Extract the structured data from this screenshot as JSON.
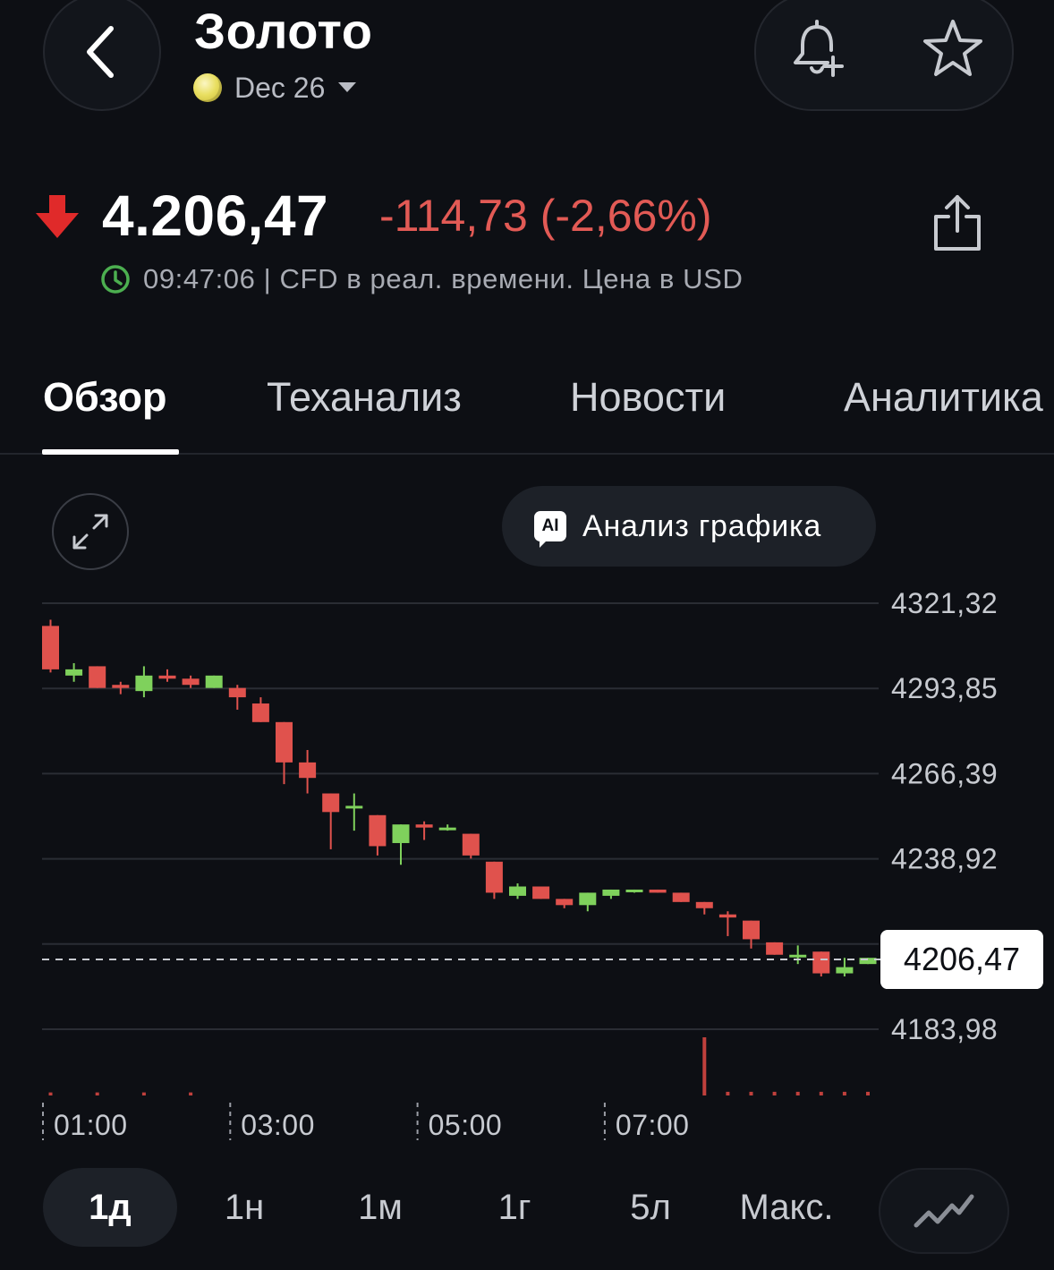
{
  "header": {
    "title": "Золото",
    "contract": "Dec 26",
    "back_icon": "chevron-left-icon",
    "alert_icon": "bell-plus-icon",
    "watchlist_icon": "star-icon"
  },
  "quote": {
    "price": "4.206,47",
    "change": "-114,73 (-2,66%)",
    "direction_icon": "arrow-down-icon",
    "meta": "09:47:06 | CFD в реал. времени. Цена в USD",
    "colors": {
      "down": "#e25a55",
      "up": "#7fd15c",
      "clock": "#4caf50"
    }
  },
  "tabs": [
    {
      "label": "Обзор",
      "active": true
    },
    {
      "label": "Теханализ",
      "active": false
    },
    {
      "label": "Новости",
      "active": false
    },
    {
      "label": "Аналитика",
      "active": false
    }
  ],
  "chart_controls": {
    "ai_button_label": "Анализ графика",
    "ai_badge": "AI",
    "expand_icon": "expand-icon"
  },
  "chart_data": {
    "type": "candlestick",
    "y_ticks": [
      4321.32,
      4293.85,
      4266.39,
      4238.92,
      4211.45,
      4183.98
    ],
    "y_tick_labels": [
      "4321,32",
      "4293,85",
      "4266,39",
      "4238,92",
      "",
      "4183,98"
    ],
    "ylim": [
      4183.98,
      4321.32
    ],
    "current_price": 4206.47,
    "current_price_label": "4206,47",
    "x_tick_labels": [
      "01:00",
      "03:00",
      "05:00",
      "07:00"
    ],
    "grid": true,
    "colors": {
      "up": "#7fd15c",
      "down": "#e0524d",
      "volume": "#c0403c"
    },
    "candles": [
      {
        "o": 4314,
        "h": 4316,
        "l": 4299,
        "c": 4300
      },
      {
        "o": 4298,
        "h": 4302,
        "l": 4296,
        "c": 4300
      },
      {
        "o": 4301,
        "h": 4301,
        "l": 4294,
        "c": 4294
      },
      {
        "o": 4295,
        "h": 4296,
        "l": 4292,
        "c": 4294
      },
      {
        "o": 4293,
        "h": 4301,
        "l": 4291,
        "c": 4298
      },
      {
        "o": 4298,
        "h": 4300,
        "l": 4296,
        "c": 4297
      },
      {
        "o": 4297,
        "h": 4298,
        "l": 4294,
        "c": 4295
      },
      {
        "o": 4294,
        "h": 4298,
        "l": 4294,
        "c": 4298
      },
      {
        "o": 4294,
        "h": 4295,
        "l": 4287,
        "c": 4291
      },
      {
        "o": 4289,
        "h": 4291,
        "l": 4283,
        "c": 4283
      },
      {
        "o": 4283,
        "h": 4283,
        "l": 4263,
        "c": 4270
      },
      {
        "o": 4270,
        "h": 4274,
        "l": 4260,
        "c": 4265
      },
      {
        "o": 4260,
        "h": 4260,
        "l": 4242,
        "c": 4254
      },
      {
        "o": 4256,
        "h": 4260,
        "l": 4248,
        "c": 4256
      },
      {
        "o": 4253,
        "h": 4253,
        "l": 4240,
        "c": 4243
      },
      {
        "o": 4244,
        "h": 4250,
        "l": 4237,
        "c": 4250
      },
      {
        "o": 4250,
        "h": 4251,
        "l": 4245,
        "c": 4249
      },
      {
        "o": 4249,
        "h": 4250,
        "l": 4248,
        "c": 4249
      },
      {
        "o": 4247,
        "h": 4247,
        "l": 4239,
        "c": 4240
      },
      {
        "o": 4238,
        "h": 4238,
        "l": 4226,
        "c": 4228
      },
      {
        "o": 4227,
        "h": 4231,
        "l": 4226,
        "c": 4230
      },
      {
        "o": 4230,
        "h": 4230,
        "l": 4226,
        "c": 4226
      },
      {
        "o": 4226,
        "h": 4226,
        "l": 4223,
        "c": 4224
      },
      {
        "o": 4224,
        "h": 4228,
        "l": 4222,
        "c": 4228
      },
      {
        "o": 4227,
        "h": 4229,
        "l": 4226,
        "c": 4229
      },
      {
        "o": 4229,
        "h": 4229,
        "l": 4228,
        "c": 4229
      },
      {
        "o": 4229,
        "h": 4229,
        "l": 4228,
        "c": 4228
      },
      {
        "o": 4228,
        "h": 4228,
        "l": 4225,
        "c": 4225
      },
      {
        "o": 4225,
        "h": 4225,
        "l": 4221,
        "c": 4223
      },
      {
        "o": 4221,
        "h": 4222,
        "l": 4214,
        "c": 4220
      },
      {
        "o": 4219,
        "h": 4219,
        "l": 4210,
        "c": 4213
      },
      {
        "o": 4212,
        "h": 4212,
        "l": 4208,
        "c": 4208
      },
      {
        "o": 4208,
        "h": 4211,
        "l": 4205,
        "c": 4208
      },
      {
        "o": 4209,
        "h": 4209,
        "l": 4201,
        "c": 4202
      },
      {
        "o": 4202,
        "h": 4207,
        "l": 4201,
        "c": 4204
      },
      {
        "o": 4205,
        "h": 4207,
        "l": 4205,
        "c": 4207
      }
    ],
    "volume": [
      2,
      0,
      2,
      0,
      2,
      0,
      2,
      0,
      0,
      0,
      0,
      0,
      0,
      0,
      0,
      0,
      0,
      0,
      0,
      0,
      0,
      0,
      0,
      0,
      0,
      0,
      0,
      0,
      90,
      3,
      3,
      3,
      3,
      3,
      3,
      3
    ]
  },
  "ranges": [
    {
      "label": "1д",
      "active": true
    },
    {
      "label": "1н",
      "active": false
    },
    {
      "label": "1м",
      "active": false
    },
    {
      "label": "1г",
      "active": false
    },
    {
      "label": "5л",
      "active": false
    },
    {
      "label": "Макс.",
      "active": false
    }
  ],
  "chart_type_icon": "line-chart-icon"
}
